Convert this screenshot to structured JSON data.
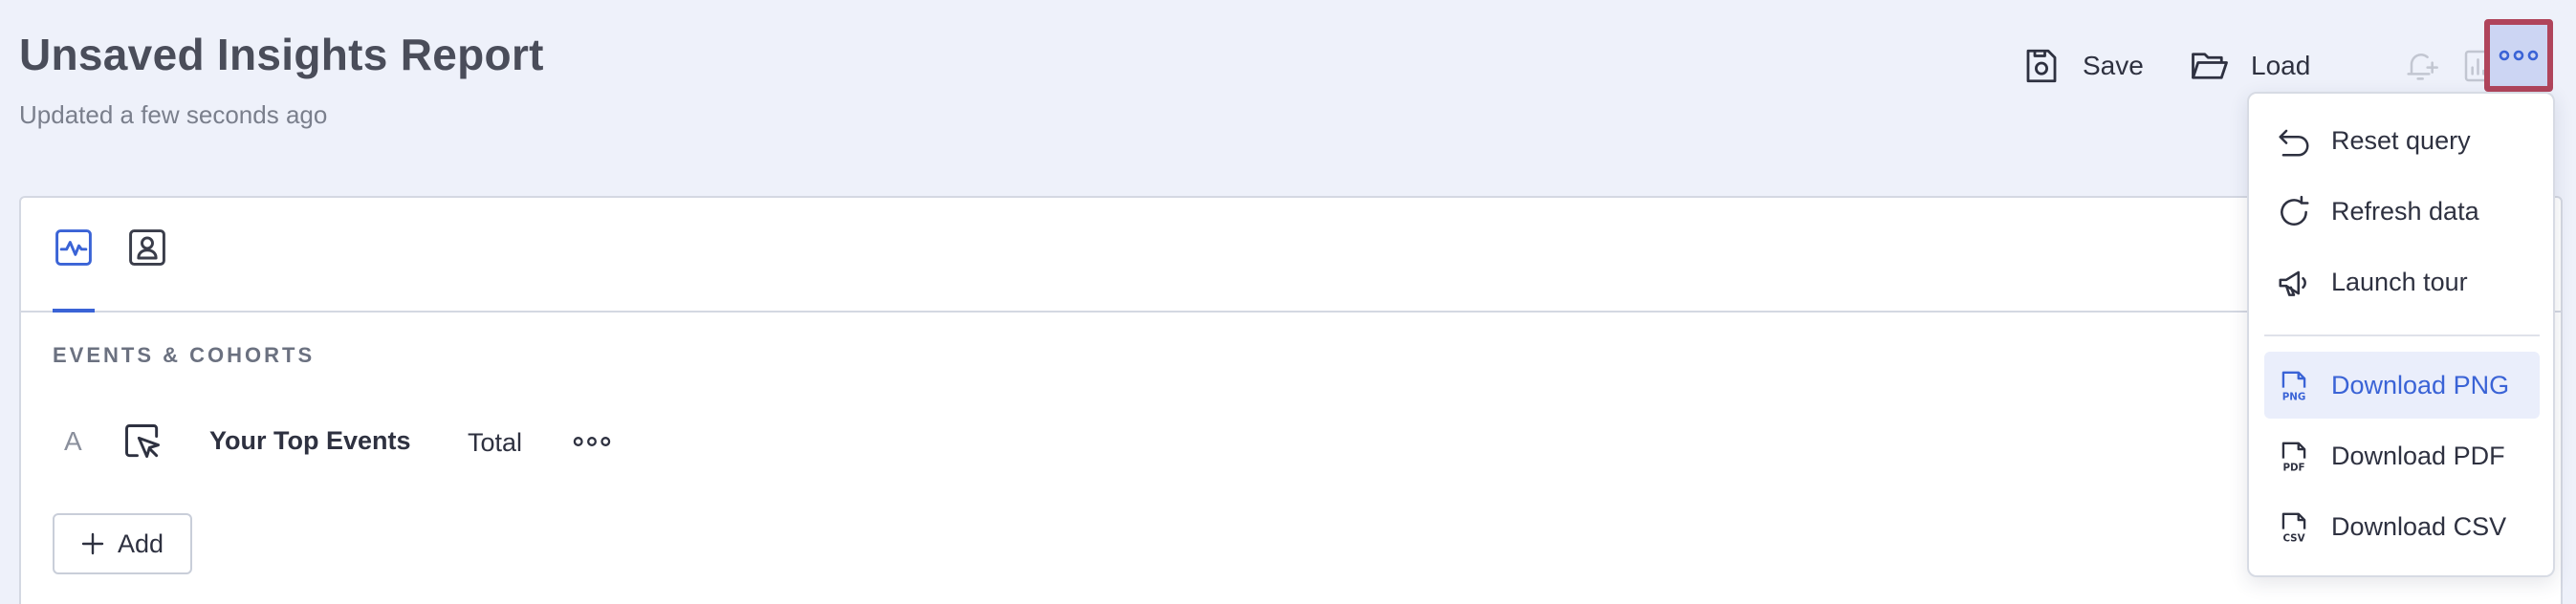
{
  "header": {
    "title": "Unsaved Insights Report",
    "updated": "Updated a few seconds ago"
  },
  "toolbar": {
    "save_label": "Save",
    "load_label": "Load",
    "icons": [
      "save-icon",
      "folder-icon",
      "alert-icon",
      "add-to-dashboard-icon",
      "more-icon"
    ]
  },
  "panel": {
    "tabs": [
      {
        "icon": "chart-line-icon",
        "active": true
      },
      {
        "icon": "person-card-icon",
        "active": false
      }
    ],
    "section_label": "EVENTS & COHORTS",
    "events": [
      {
        "letter": "A",
        "icon": "cursor-click-icon",
        "name": "Your Top Events",
        "measure": "Total"
      }
    ],
    "add_label": "Add"
  },
  "menu": {
    "items": [
      {
        "label": "Reset query",
        "icon": "undo-icon"
      },
      {
        "label": "Refresh data",
        "icon": "refresh-icon"
      },
      {
        "label": "Launch tour",
        "icon": "megaphone-icon"
      },
      {
        "label": "Download PNG",
        "icon": "png-file-icon",
        "highlighted": true
      },
      {
        "label": "Download PDF",
        "icon": "pdf-file-icon"
      },
      {
        "label": "Download CSV",
        "icon": "csv-file-icon"
      }
    ]
  },
  "colors": {
    "accent": "#3a63d6",
    "background": "#eef1fa",
    "focus_border": "#b0445b",
    "highlight_bg": "#eaeefb"
  }
}
